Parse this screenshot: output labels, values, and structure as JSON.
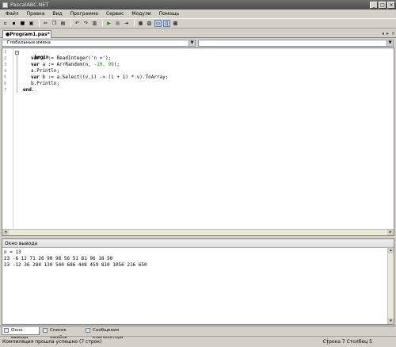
{
  "window": {
    "title": "PascalABC.NET"
  },
  "menu": [
    "Файл",
    "Правка",
    "Вид",
    "Программа",
    "Сервис",
    "Модули",
    "Помощь"
  ],
  "toolbar": {
    "buttons": [
      "new-icon",
      "open-icon",
      "save-icon",
      "save-all-icon",
      "cut-icon",
      "copy-icon",
      "paste-icon",
      "undo-icon",
      "redo-icon",
      "compile-icon",
      "run-icon",
      "stop-icon",
      "step-icon",
      "form-icon",
      "layout-icon",
      "output-window-icon",
      "debug-icon",
      "help-icon"
    ],
    "glyphs": [
      "▫",
      "▪",
      "■",
      "▣",
      "✂",
      "❐",
      "▤",
      "↶",
      "↷",
      "▥",
      "▶",
      "■",
      "⇥",
      "▦",
      "▧",
      "▭",
      "▯",
      "▩"
    ]
  },
  "tabs": [
    {
      "label": "●Program1.pas*"
    }
  ],
  "editor": {
    "scope_combo": "Глобальные имена",
    "lines": [
      "1",
      "2",
      "3",
      "4",
      "5",
      "6",
      "7"
    ]
  },
  "code": {
    "l1": {
      "kw": "begin"
    },
    "l2": {
      "kw": "var",
      "a": " n := ReadInteger(",
      "s": "'n ='",
      "b": ");"
    },
    "l3": {
      "kw": "var",
      "a": " a := ArrRandom(n, ",
      "n": "-10, 99",
      "b": ");"
    },
    "l4": {
      "a": "a.Println;"
    },
    "l5": {
      "kw": "var",
      "a": " b := a.Select((v,i) -> (i + 1) * v).ToArray;"
    },
    "l6": {
      "a": "b.Println;"
    },
    "l7": {
      "kw": "end",
      "a": "."
    }
  },
  "output": {
    "title": "Окно вывода",
    "lines": [
      "n = 13",
      "23 -6 12 71 26 90 98 56 51 81 96 18 50",
      "23 -12 36 284 130 540 686 448 459 810 1056 216 650"
    ]
  },
  "bottom_tabs": [
    {
      "label": "Окно вывода",
      "icon": "output-window-icon"
    },
    {
      "label": "Список ошибок",
      "icon": "error-list-icon"
    },
    {
      "label": "Сообщения компилятора",
      "icon": "compiler-messages-icon"
    }
  ],
  "status": {
    "message": "Компиляция прошла успешно (7 строк)",
    "row_label": "Строка",
    "row_value": "7",
    "col_label": "Столбец",
    "col_value": "5"
  }
}
